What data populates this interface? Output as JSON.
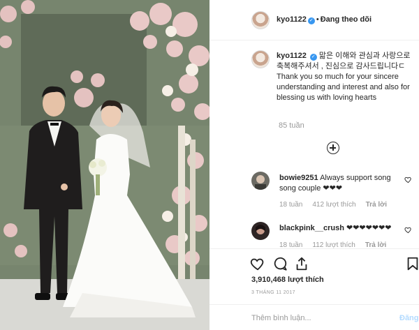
{
  "post": {
    "username": "kyo1122",
    "verified_icon": "verified-badge-icon",
    "separator": "•",
    "follow_status": "Đang theo dõi",
    "caption": "맒은 이해와 관심과 사랑으로 축복해주셔서 , 진심으로 감사드립니다ㄷ Thank you so much for your sincere understanding and interest and also for blessing us with loving hearts",
    "caption_time": "85 tuần"
  },
  "comments": [
    {
      "username": "bowie9251",
      "text": "Always support song song couple ❤❤❤",
      "time": "18 tuần",
      "likes": "412 lượt thích",
      "reply": "Trả lời"
    },
    {
      "username": "blackpink__crush",
      "text": "❤❤❤❤❤❤❤",
      "time": "18 tuần",
      "likes": "112 lượt thích",
      "reply": "Trả lời"
    }
  ],
  "actions": {
    "like_icon": "heart-icon",
    "comment_icon": "comment-icon",
    "share_icon": "share-icon",
    "save_icon": "bookmark-icon",
    "likes_count": "3,910,468",
    "likes_label": "lượt thích",
    "date": "3 THÁNG 11 2017"
  },
  "composer": {
    "placeholder": "Thêm bình luận...",
    "post_label": "Đăng"
  },
  "colors": {
    "accent_blue": "#3897f0",
    "post_button_disabled": "#b3dbff",
    "text_primary": "#262626",
    "text_secondary": "#999999"
  }
}
